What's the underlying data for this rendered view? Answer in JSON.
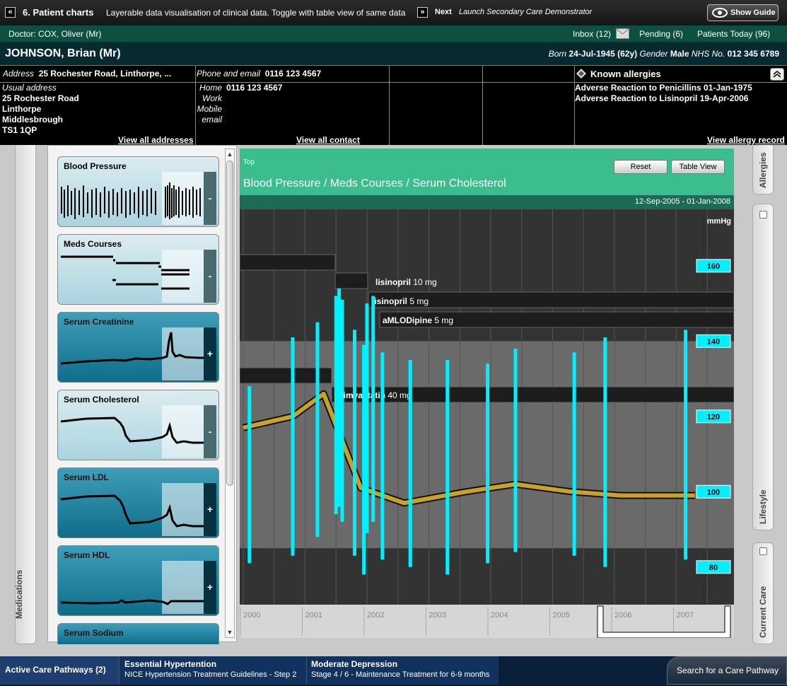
{
  "topbar": {
    "back_icon": "double-chevron-left-icon",
    "title": "6. Patient charts",
    "subtitle": "Layerable data visualisation of clinical data. Toggle with table view of same data",
    "next_icon": "double-chevron-right-icon",
    "next_label": "Next",
    "next_desc": "Launch Secondary Care Demonstrator",
    "guide_label": "Show Guide",
    "guide_icon": "eye-icon"
  },
  "doctorbar": {
    "doctor": "Doctor: COX, Oliver (Mr)",
    "inbox": "Inbox (12)",
    "inbox_icon": "envelope-icon",
    "pending": "Pending (6)",
    "patients_today": "Patients Today (96)"
  },
  "patient": {
    "name": "JOHNSON, Brian (Mr)",
    "born_label": "Born",
    "born": "24-Jul-1945",
    "age": "(62y)",
    "gender_label": "Gender",
    "gender": "Male",
    "nhs_label": "NHS No.",
    "nhs": "012 345 6789"
  },
  "info": {
    "address_label": "Address",
    "address_summary": "25 Rochester Road, Linthorpe, ...",
    "usual_address_label": "Usual address",
    "address_lines": [
      "25 Rochester Road",
      "Linthorpe",
      "Middlesbrough",
      "TS1 1QP"
    ],
    "view_addresses": "View all addresses",
    "phone_label": "Phone and email",
    "phone_summary": "0116 123 4567",
    "home_label": "Home",
    "home_value": "0116 123 4567",
    "work_label": "Work",
    "mobile_label": "Mobile",
    "email_label": "email",
    "view_contacts": "View all contact details",
    "allergies_label": "Known allergies",
    "allergies_icon": "allergy-diamond-icon",
    "allergies": [
      "Adverse Reaction to Penicillins 01-Jan-1975",
      "Adverse Reaction to Lisinopril 19-Apr-2006"
    ],
    "view_allergies": "View allergy record",
    "collapse_icon": "collapse-up-icon"
  },
  "left": {
    "medications_label": "Medications"
  },
  "tiles": [
    {
      "title": "Blood Pressure",
      "toggle": "-",
      "style": "light"
    },
    {
      "title": "Meds Courses",
      "toggle": "-",
      "style": "light"
    },
    {
      "title": "Serum Creatinine",
      "toggle": "+",
      "style": "dark"
    },
    {
      "title": "Serum Cholesterol",
      "toggle": "-",
      "style": "light"
    },
    {
      "title": "Serum LDL",
      "toggle": "+",
      "style": "dark"
    },
    {
      "title": "Serum HDL",
      "toggle": "+",
      "style": "dark"
    },
    {
      "title": "Serum Sodium",
      "toggle": "",
      "style": "dark"
    }
  ],
  "chart": {
    "top_label": "Top",
    "reset_label": "Reset",
    "table_view_label": "Table View",
    "breadcrumb": "Blood Pressure  /  Meds Courses  /  Serum Cholesterol",
    "date_range": "12-Sep-2005 - 01-Jan-2008",
    "unit": "mmHg",
    "ticks": [
      "160",
      "140",
      "120",
      "100",
      "80"
    ],
    "years": [
      "2000",
      "2001",
      "2002",
      "2003",
      "2004",
      "2005",
      "2006",
      "2007"
    ],
    "meds": [
      {
        "drug": "lisinopril",
        "dose": "10 mg"
      },
      {
        "drug": "lisinopril",
        "dose": "5 mg"
      },
      {
        "drug": "aMLODipine",
        "dose": "5 mg"
      },
      {
        "drug": "simvastatin",
        "dose": "40 mg"
      }
    ]
  },
  "chart_data": {
    "type": "bar",
    "ylabel": "mmHg",
    "ylim": [
      70,
      175
    ],
    "x": [
      "2000",
      "2001",
      "2002",
      "2003",
      "2004",
      "2005",
      "2006",
      "2007"
    ],
    "blood_pressure_ranges": [
      {
        "x": "2000.1",
        "systolic": 128,
        "diastolic": 81
      },
      {
        "x": "2000.8",
        "systolic": 141,
        "diastolic": 83
      },
      {
        "x": "2001.2",
        "systolic": 145,
        "diastolic": 88
      },
      {
        "x": "2001.5",
        "systolic": 152,
        "diastolic": 94
      },
      {
        "x": "2001.55",
        "systolic": 154,
        "diastolic": 96
      },
      {
        "x": "2001.6",
        "systolic": 151,
        "diastolic": 92
      },
      {
        "x": "2001.8",
        "systolic": 143,
        "diastolic": 83
      },
      {
        "x": "2001.95",
        "systolic": 139,
        "diastolic": 78
      },
      {
        "x": "2002.0",
        "systolic": 150,
        "diastolic": 89
      },
      {
        "x": "2002.1",
        "systolic": 152,
        "diastolic": 92
      },
      {
        "x": "2002.25",
        "systolic": 137,
        "diastolic": 82
      },
      {
        "x": "2002.7",
        "systolic": 135,
        "diastolic": 80
      },
      {
        "x": "2003.3",
        "systolic": 135,
        "diastolic": 78
      },
      {
        "x": "2003.95",
        "systolic": 134,
        "diastolic": 81
      },
      {
        "x": "2004.4",
        "systolic": 138,
        "diastolic": 84
      },
      {
        "x": "2005.35",
        "systolic": 137,
        "diastolic": 83
      },
      {
        "x": "2005.85",
        "systolic": 141,
        "diastolic": 80
      },
      {
        "x": "2007.15",
        "systolic": 143,
        "diastolic": 82
      }
    ],
    "cholesterol_trend": [
      {
        "x": "2000.0",
        "y": 117
      },
      {
        "x": "2000.8",
        "y": 120
      },
      {
        "x": "2001.3",
        "y": 126
      },
      {
        "x": "2001.9",
        "y": 101
      },
      {
        "x": "2002.6",
        "y": 97
      },
      {
        "x": "2003.6",
        "y": 100
      },
      {
        "x": "2004.4",
        "y": 102
      },
      {
        "x": "2005.3",
        "y": 100
      },
      {
        "x": "2006.1",
        "y": 99
      },
      {
        "x": "2007.3",
        "y": 99
      }
    ]
  },
  "rightcol": {
    "allergies": "Allergies",
    "lifestyle": "Lifestyle",
    "current_care": "Current Care"
  },
  "bottom": {
    "active_pathways": "Active Care Pathways (2)",
    "p1_title": "Essential Hypertention",
    "p1_sub": "NICE Hypertension Treatment Guidelines - Step 2",
    "p2_title": "Moderate Depression",
    "p2_sub": "Stage 4 / 6 - Maintenance Treatment for 6-9 months",
    "search": "Search for a Care Pathway"
  }
}
